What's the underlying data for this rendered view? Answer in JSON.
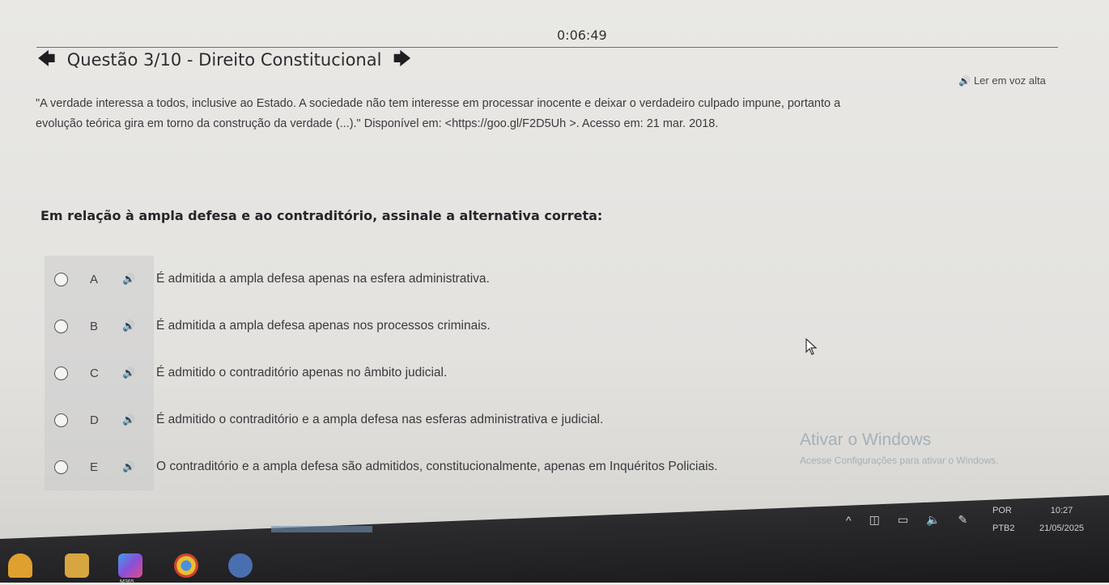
{
  "timer": "0:06:49",
  "header": {
    "title": "Questão 3/10 - Direito Constitucional",
    "prev_icon": "arrow-left-icon",
    "next_icon": "arrow-right-icon"
  },
  "tts": {
    "label": "Ler em voz alta",
    "icon": "speaker-icon"
  },
  "quote": {
    "line1": "\"A verdade interessa a todos, inclusive ao Estado. A sociedade não tem interesse em processar inocente e deixar o verdadeiro culpado impune, portanto a",
    "line2": "evolução teórica gira em torno da construção da verdade (...).\" Disponível em: <https://goo.gl/F2D5Uh >. Acesso em: 21 mar. 2018."
  },
  "question": "Em relação à ampla defesa e ao contraditório, assinale a alternativa correta:",
  "options": [
    {
      "letter": "A",
      "text": "É admitida a ampla defesa apenas na esfera administrativa."
    },
    {
      "letter": "B",
      "text": "É admitida a ampla defesa apenas nos processos criminais."
    },
    {
      "letter": "C",
      "text": "É admitido o contraditório apenas no âmbito judicial."
    },
    {
      "letter": "D",
      "text": "É admitido o contraditório e a ampla defesa nas esferas administrativa e judicial."
    },
    {
      "letter": "E",
      "text": "O contraditório e a ampla defesa são admitidos, constitucionalmente, apenas em Inquéritos Policiais."
    }
  ],
  "watermark": {
    "line1": "Ativar o Windows",
    "line2": "Acesse Configurações para ativar o Windows."
  },
  "taskbar": {
    "lang_top": "POR",
    "lang_bottom": "PTB2",
    "time": "10:27",
    "date": "21/05/2025",
    "app_label": "M365"
  },
  "colors": {
    "accent": "#3a3a3c",
    "background": "#e6e5e2"
  }
}
